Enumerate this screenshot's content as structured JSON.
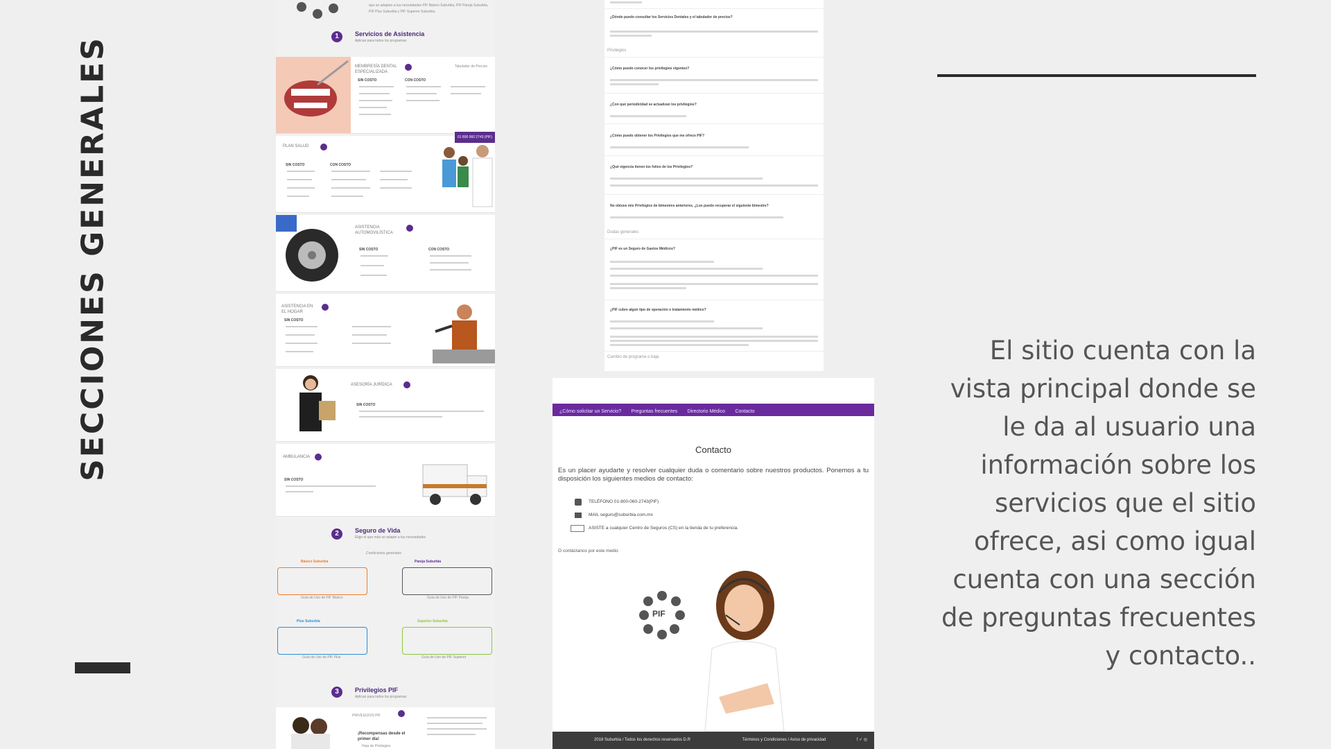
{
  "slide": {
    "title": "SECCIONES GENERALES",
    "description": "El sitio cuenta con la vista principal donde se le da al usuario una información sobre los servicios que el sitio ofrece, asi como igual cuenta con una sección de preguntas frecuentes y contacto.."
  },
  "home_page": {
    "intro_text": "que se adaptan a tus necesidades PIF Básico Suburbia, PIF Pareja Suburbia, PIF Plus Suburbia y PIF Superior Suburbia.",
    "sections": [
      {
        "number": "1",
        "title": "Servicios de Asistencia",
        "subtitle": "Aplican para todos los programas"
      },
      {
        "number": "2",
        "title": "Seguro de Vida",
        "subtitle": "Elige el que más se adapte a tus necesidades"
      },
      {
        "number": "3",
        "title": "Privilegios PIF",
        "subtitle": "Aplican para todos los programas"
      }
    ],
    "cards": [
      {
        "title": "MEMBRESÍA DENTAL ESPECIALIZADA",
        "left_label": "SIN COSTO",
        "right_label": "CON COSTO",
        "extra": "Tabulador de Precios"
      },
      {
        "title": "PLAN SALUD",
        "left_label": "SIN COSTO",
        "right_label": "CON COSTO"
      },
      {
        "title": "ASISTENCIA AUTOMOVILÍSTICA",
        "left_label": "SIN COSTO",
        "right_label": "CON COSTO"
      },
      {
        "title": "ASISTENCIA EN EL HOGAR",
        "left_label": "SIN COSTO",
        "right_label": ""
      },
      {
        "title": "ASESORÍA JURÍDICA",
        "left_label": "SIN COSTO",
        "right_label": ""
      },
      {
        "title": "AMBULANCIA",
        "left_label": "SIN COSTO",
        "right_label": ""
      }
    ],
    "phone_badge": "01 800 060 2743 (PIF)",
    "insurance_note": "Condiciones generales",
    "plans": [
      {
        "name": "Básico Suburbia",
        "guide": "Guía de Uso de PIF Básico",
        "color": "#f07a2a"
      },
      {
        "name": "Pareja Suburbia",
        "guide": "Guía de Uso de PIF Pareja",
        "color": "#5b2d8e"
      },
      {
        "name": "Plus Suburbia",
        "guide": "Guía de Uso de PIF Plus",
        "color": "#2a8fd8"
      },
      {
        "name": "Superior Suburbia",
        "guide": "Guía de Uso de PIF Superior",
        "color": "#8dc63f"
      }
    ],
    "privileges": {
      "title": "PRIVILEGIOS PIF",
      "tagline": "¡Recompensas desde el primer día!",
      "link": "Hoja de Privilegios"
    }
  },
  "faq_page": {
    "categories": [
      "Privilegios",
      "Dudas generales",
      "Cambio de programa o baja"
    ],
    "questions": [
      "¿Dónde puedo consultar los Servicios Dentales y el tabulador de precios?",
      "¿Cómo puedo conocer los privilegios vigentes?",
      "¿Con qué periodicidad se actualizan los privilegios?",
      "¿Cómo puedo obtener los Privilegios que me ofrece PIF?",
      "¿Qué vigencia tienen los folios de los Privilegios?",
      "No obtuve mis Privilegios de bimestres anteriores, ¿Los puedo recuperar el siguiente bimestre?",
      "¿PIF es un Seguro de Gastos Médicos?",
      "¿PIF cubre algún tipo de operación o tratamiento médico?"
    ]
  },
  "contact_page": {
    "nav": [
      "¿Cómo solicitar un Servicio?",
      "Preguntas frecuentes",
      "Directorio Médico",
      "Contacto"
    ],
    "heading": "Contacto",
    "intro": "Es un placer ayudarte y resolver cualquier duda o comentario sobre nuestros productos. Ponemos a tu disposición los siguientes medios de contacto:",
    "phone": "TELÉFONO 01-800-060-2743(PIF)",
    "mail": "MAIL seguro@suburbia.com.mx",
    "visit": "ASISTE a cualquier Centro de Seguros (CS) en la tienda de tu preferencia.",
    "alt": "O contáctanos por este medio",
    "logo_text": "PIF",
    "footer_left": "2018 Suburbia / Todos los derechos reservados D.R",
    "footer_right": "Términos y Condiciones / Aviso de privacidad",
    "brand_color": "#6a2a9e"
  }
}
